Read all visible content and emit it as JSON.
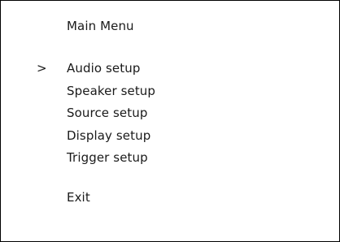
{
  "menu": {
    "title": "Main Menu",
    "cursor_symbol": ">",
    "selected_index": 0,
    "items": [
      {
        "label": "Audio setup"
      },
      {
        "label": "Speaker setup"
      },
      {
        "label": "Source setup"
      },
      {
        "label": "Display setup"
      },
      {
        "label": "Trigger setup"
      }
    ],
    "exit_label": "Exit"
  }
}
